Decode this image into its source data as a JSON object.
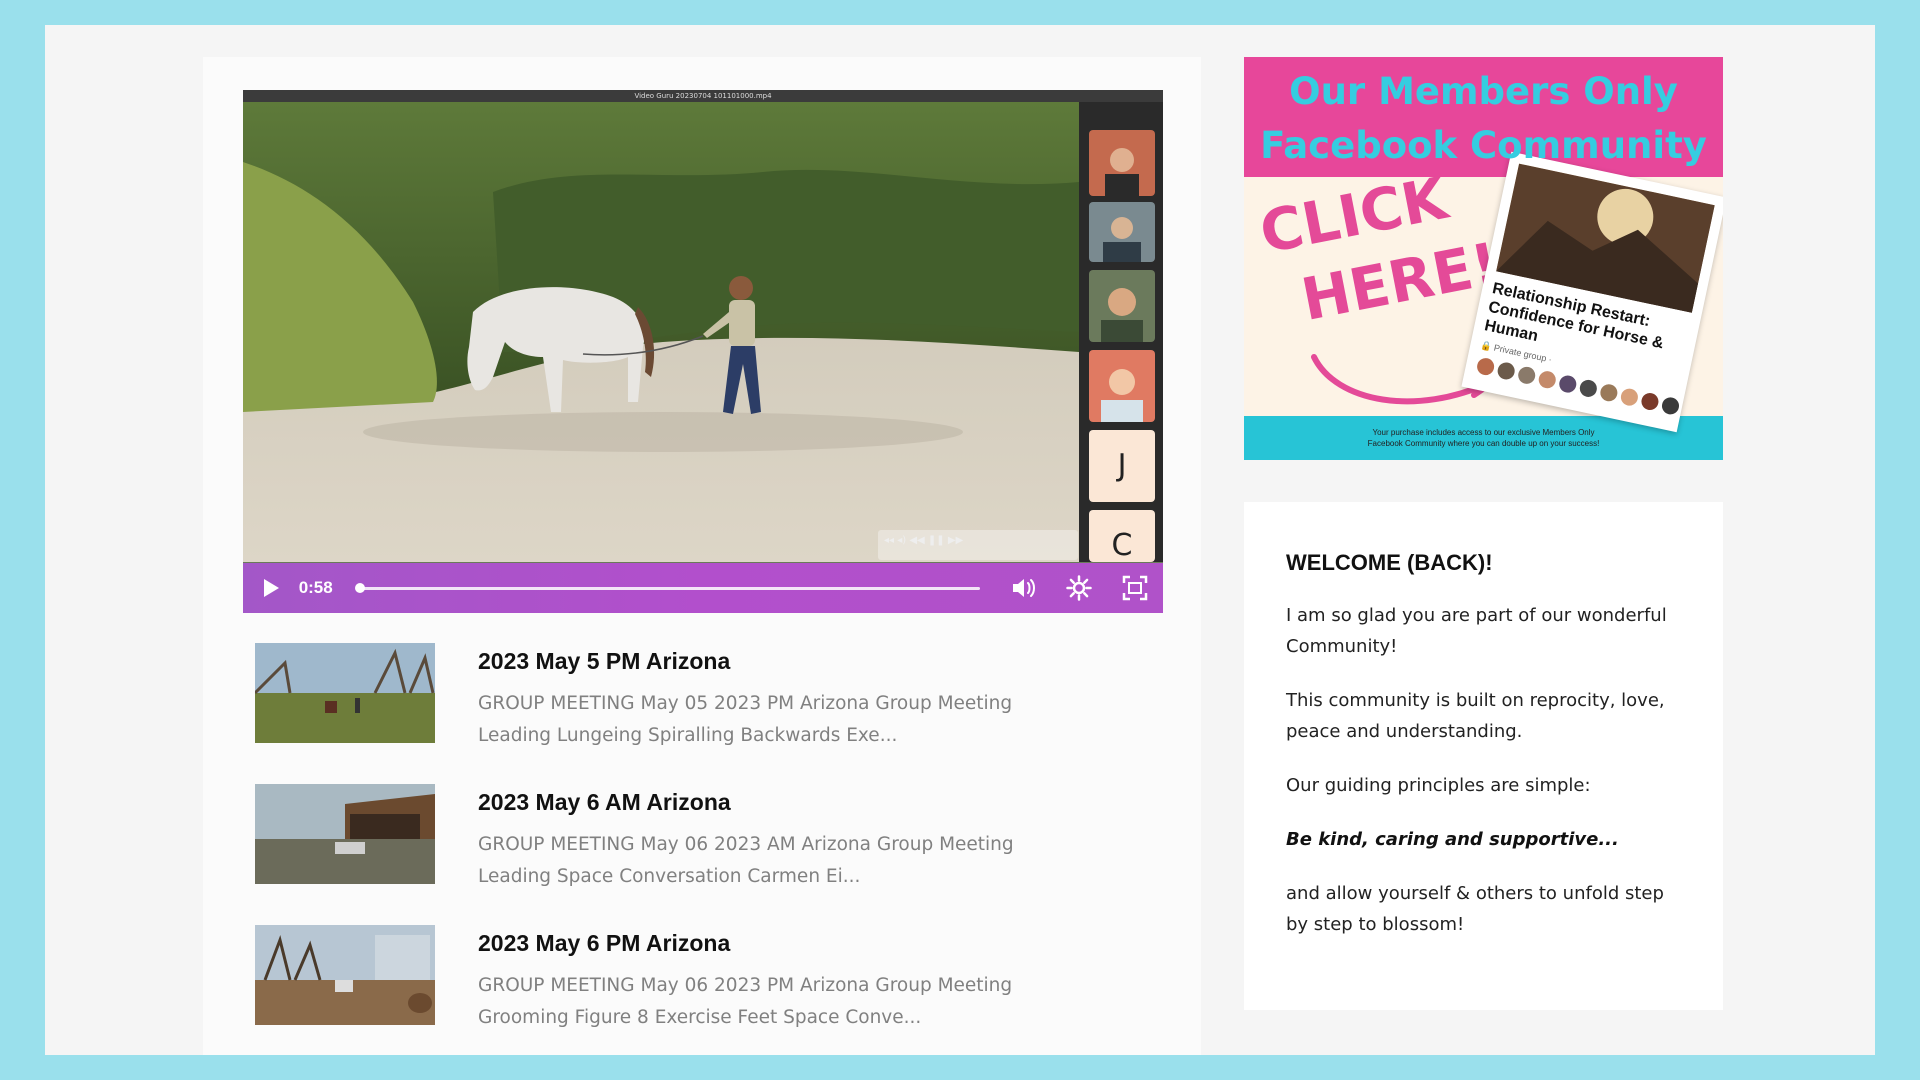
{
  "video": {
    "top_bar_text": "Video Guru 20230704 101101000.mp4",
    "current_time": "0:58",
    "progress": 0.0,
    "side_tile_letters": [
      "J",
      "C"
    ],
    "mini_controls_text": "◂◂  ◂)  ◀◀  ❚❚  ▶▶"
  },
  "recordings": [
    {
      "title": "2023 May 5 PM Arizona",
      "description": "GROUP MEETING May 05 2023 PM Arizona   Group Meeting Leading Lungeing Spiralling Backwards Exe..."
    },
    {
      "title": "2023 May 6 AM Arizona",
      "description": "GROUP MEETING May 06 2023 AM Arizona   Group Meeting Leading Space Conversation     Carmen Ei..."
    },
    {
      "title": "2023 May 6 PM Arizona",
      "description": "GROUP MEETING May 06 2023 PM Arizona   Group Meeting Grooming Figure 8 Exercise Feet Space Conve..."
    }
  ],
  "banner": {
    "title_line1": "Our Members Only",
    "title_line2": "Facebook Community",
    "click_line1": "CLICK",
    "click_line2": "HERE!",
    "card_title": "Relationship Restart: Confidence for Horse & Human",
    "card_sub": "🔒 Private group · ",
    "footer_line1": "Your purchase includes access to our exclusive Members Only",
    "footer_line2": "Facebook Community where you can double up on your success!",
    "colors": {
      "pink": "#e7479a",
      "cyan": "#35cde0",
      "cream": "#fdf3e6"
    }
  },
  "welcome": {
    "heading": "WELCOME (BACK)!",
    "p1": " I am so glad you are part of our wonderful Community!",
    "p2": "This community is built on reprocity, love, peace and understanding.",
    "p3": "Our guiding principles are simple:",
    "p4": "Be kind, caring and supportive...",
    "p5": "and allow yourself & others to unfold step by step to blossom!"
  },
  "icons": [
    "play-icon",
    "volume-icon",
    "settings-gear-icon",
    "fullscreen-icon"
  ],
  "theme": {
    "background": "#9ae0ec",
    "player_purple": "#a357c8"
  }
}
